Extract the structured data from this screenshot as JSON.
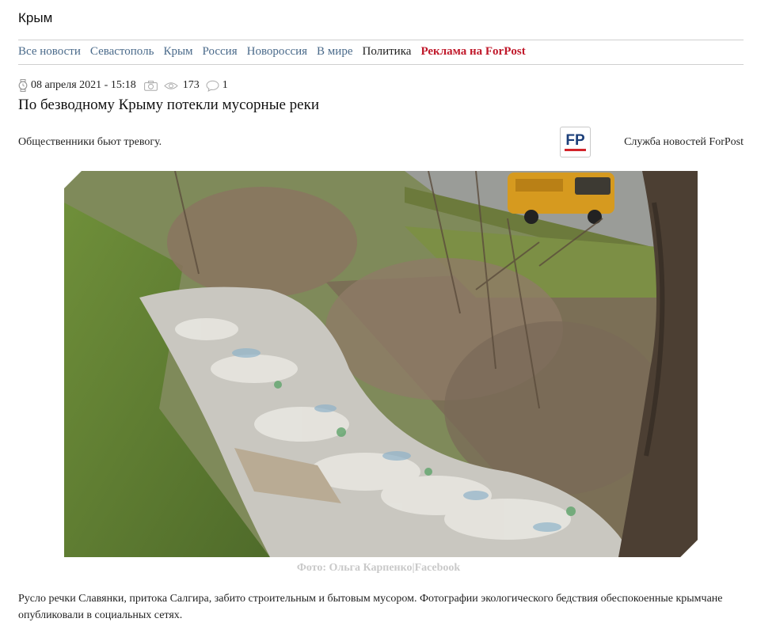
{
  "section": {
    "title": "Крым"
  },
  "nav": {
    "items": [
      {
        "label": "Все новости",
        "style": "link"
      },
      {
        "label": "Севастополь",
        "style": "link"
      },
      {
        "label": "Крым",
        "style": "link"
      },
      {
        "label": "Россия",
        "style": "link"
      },
      {
        "label": "Новороссия",
        "style": "link"
      },
      {
        "label": "В мире",
        "style": "link"
      },
      {
        "label": "Политика",
        "style": "plain"
      },
      {
        "label": "Реклама на ForPost",
        "style": "promo"
      }
    ]
  },
  "article": {
    "date": "08 апреля 2021 - 15:18",
    "views": "173",
    "comments": "1",
    "headline": "По безводному Крыму потекли мусорные реки",
    "lead": "Общественники бьют тревогу.",
    "author": "Служба новостей ForPost",
    "logo_text": "FP",
    "photo_credit": "Фото: Ольга Карпенко|Facebook",
    "body": "Русло речки Славянки, притока Салгира, забито строительным и бытовым мусором. Фотографии экологического бедствия обеспокоенные крымчане опубликовали в социальных сетях."
  },
  "colors": {
    "nav_link": "#4a6a8a",
    "promo": "#c0192b",
    "logo_blue": "#1c3f7a",
    "logo_red": "#d2232a",
    "credit": "#c9c9c9"
  },
  "icons": [
    "clock-icon",
    "camera-icon",
    "eye-icon",
    "comment-icon"
  ]
}
